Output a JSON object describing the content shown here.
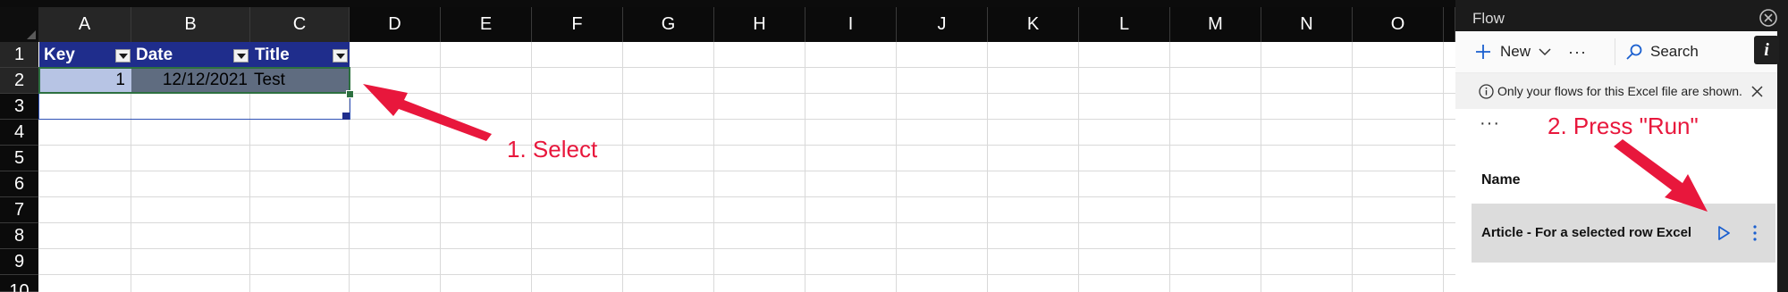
{
  "sheet": {
    "columns": [
      "A",
      "B",
      "C",
      "D",
      "E",
      "F",
      "G",
      "H",
      "I",
      "J",
      "K",
      "L",
      "M",
      "N",
      "O"
    ],
    "rows": [
      "1",
      "2",
      "3",
      "4",
      "5",
      "6",
      "7",
      "8",
      "9",
      "10"
    ],
    "table": {
      "headers": [
        "Key",
        "Date",
        "Title"
      ],
      "row": {
        "key": "1",
        "date": "12/12/2021",
        "title": "Test"
      }
    },
    "colors": {
      "table_header": "#1f2d8c",
      "selected_fill": "#5f6c80",
      "selection_border": "#2d7040",
      "annotation": "#e8173c"
    }
  },
  "annotations": {
    "step1": "1. Select",
    "step2": "2. Press \"Run\""
  },
  "flow_pane": {
    "title": "Flow",
    "close_icon": "close-icon",
    "toolbar": {
      "new_label": "New",
      "more_label": "···",
      "search_label": "Search",
      "info_label": "i"
    },
    "notice": "Only your flows for this Excel file are shown.",
    "overflow_menu": "···",
    "list_header": "Name",
    "flows": [
      {
        "name": "Article - For a selected row Excel"
      }
    ]
  }
}
